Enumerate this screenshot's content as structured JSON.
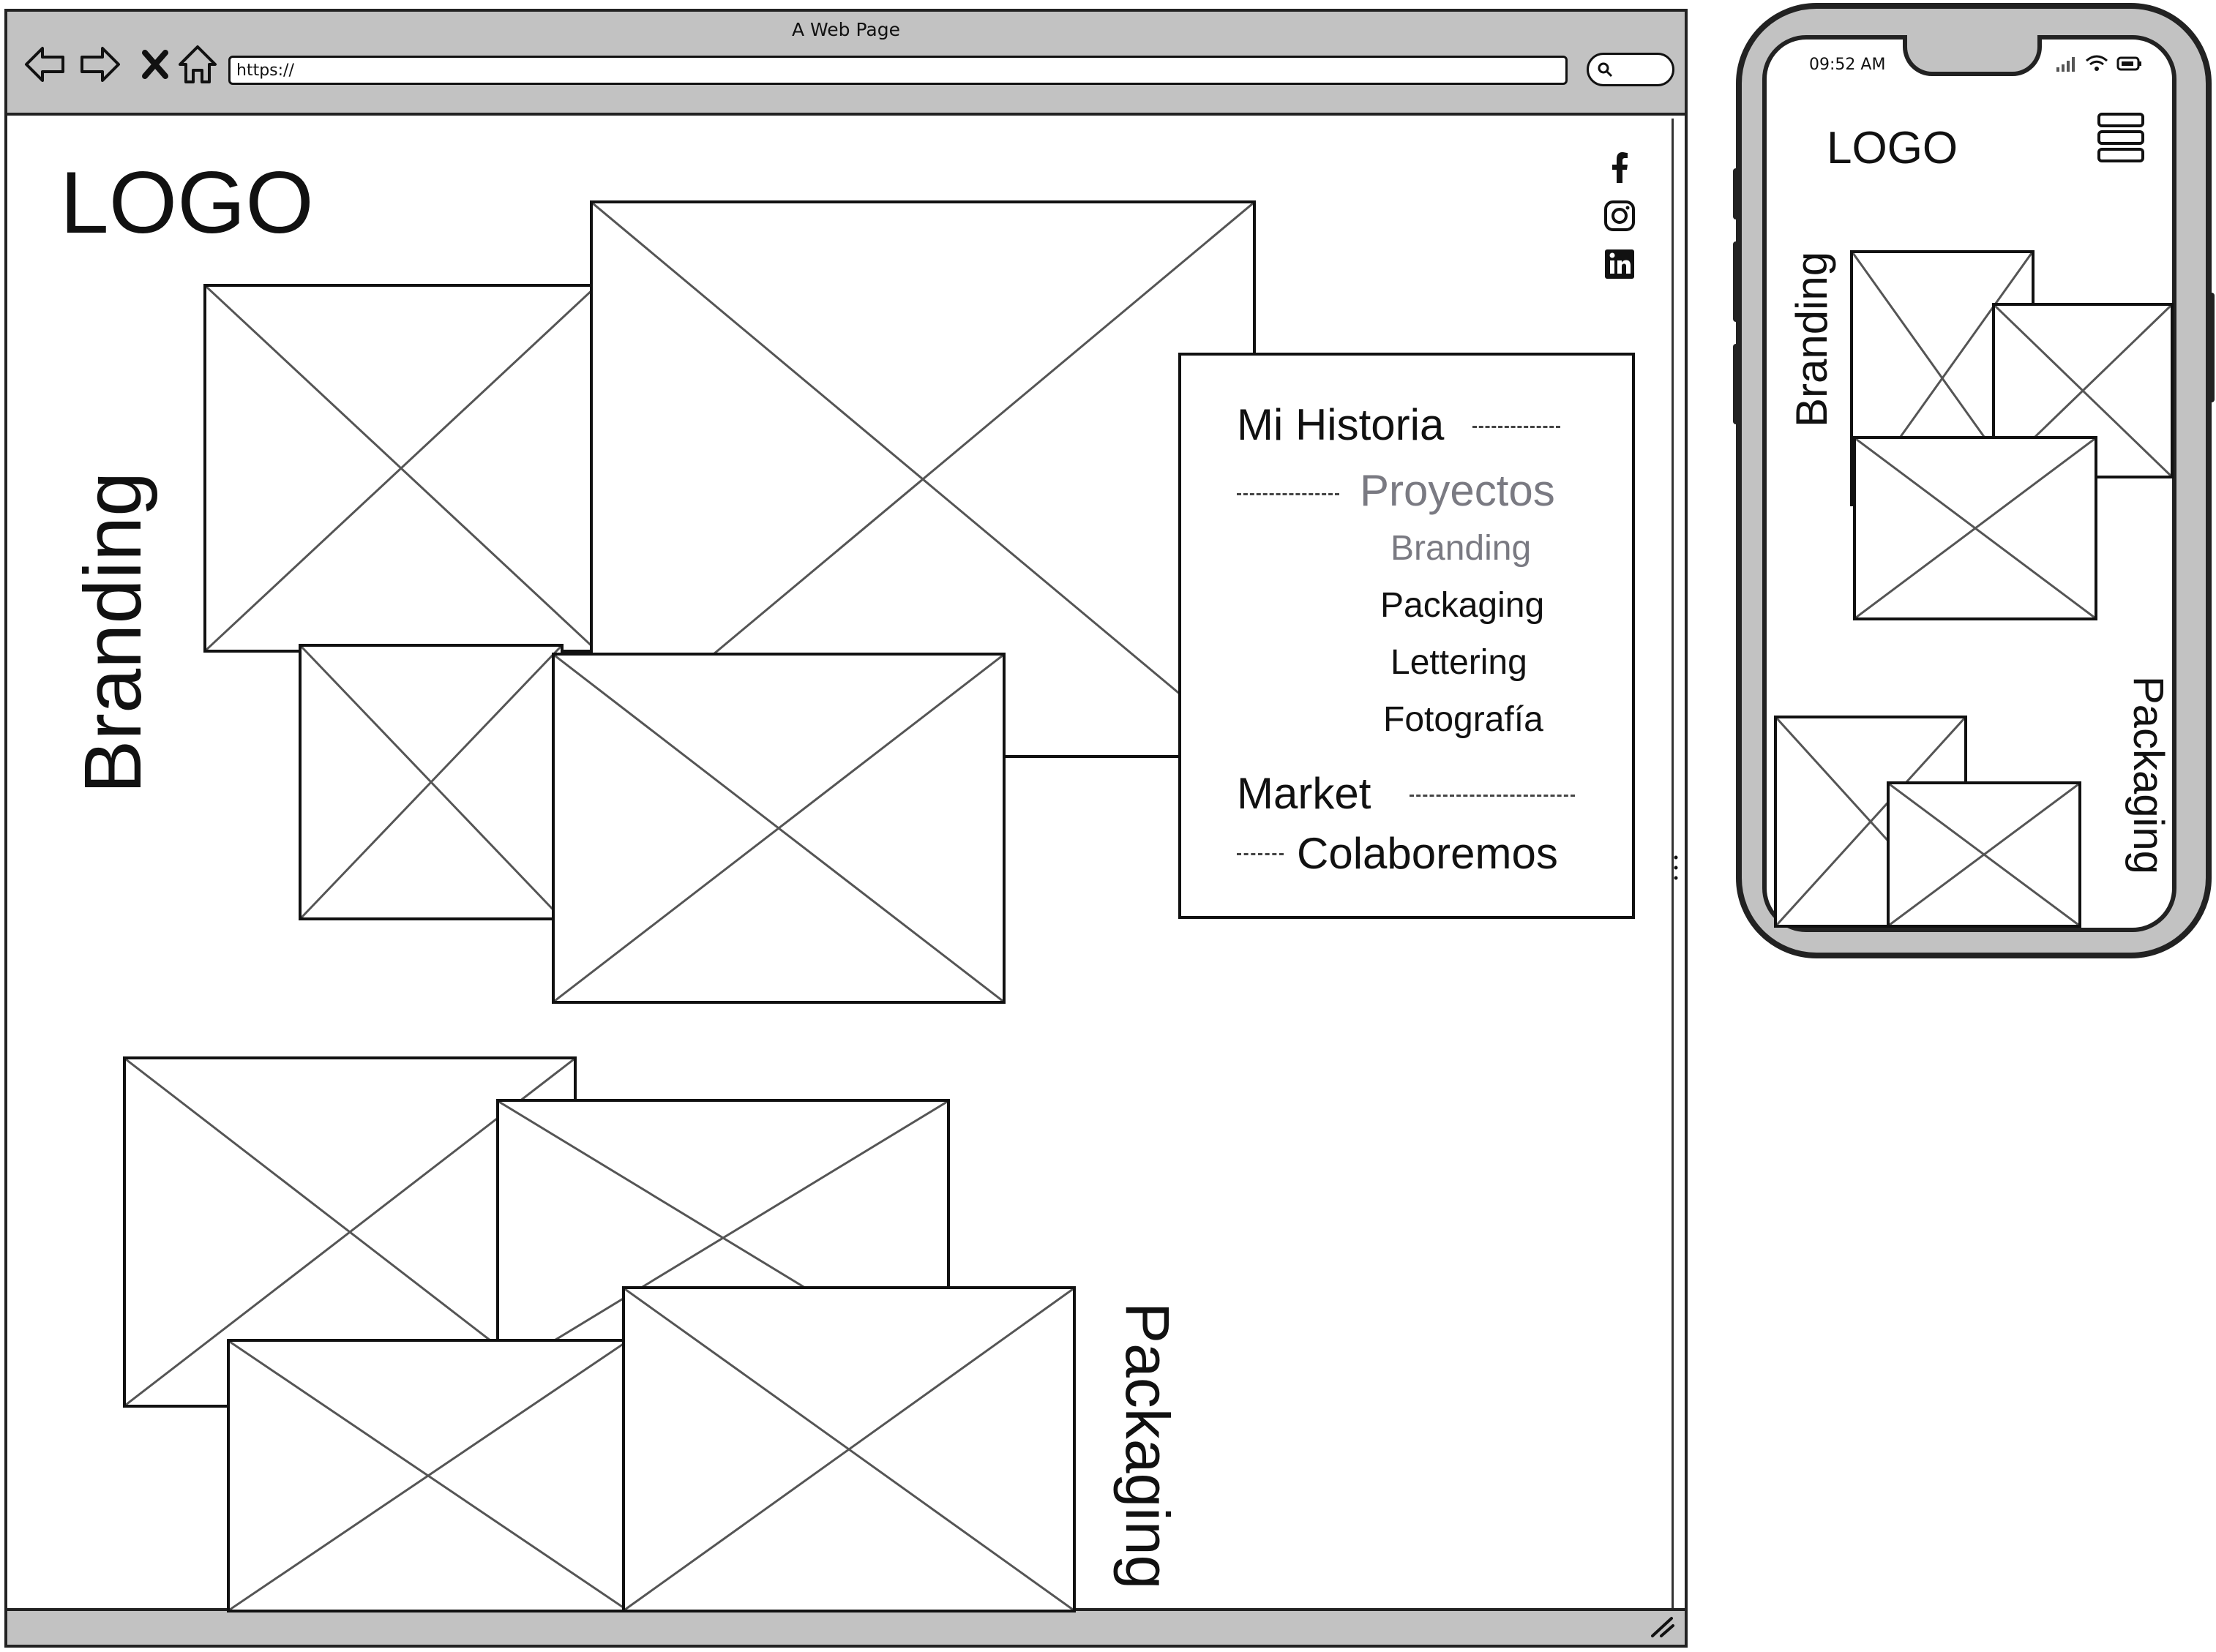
{
  "browser": {
    "window_title": "A Web Page",
    "url": "https://",
    "nav_icons": [
      "back-arrow-icon",
      "forward-arrow-icon",
      "close-x-icon",
      "home-icon"
    ],
    "search_icon": "search-icon"
  },
  "desktop": {
    "logo": "LOGO",
    "branding_label": "Branding",
    "packaging_label": "Packaging",
    "social_icons": [
      "facebook-icon",
      "instagram-icon",
      "linkedin-icon"
    ],
    "menu": {
      "mi_historia": "Mi Historia",
      "proyectos": "Proyectos",
      "sub_branding": "Branding",
      "sub_packaging": "Packaging",
      "sub_lettering": "Lettering",
      "sub_fotografia": "Fotografía",
      "market": "Market",
      "colaboremos": "Colaboremos"
    },
    "colors": {
      "active": "#7a7a82",
      "text": "#111111",
      "chrome": "#c2c2c2"
    }
  },
  "mobile": {
    "time": "09:52 AM",
    "logo": "LOGO",
    "branding_label": "Branding",
    "packaging_label": "Packaging",
    "menu_icon": "hamburger-menu-icon",
    "status_icons": [
      "signal-icon",
      "wifi-icon",
      "battery-icon"
    ]
  }
}
